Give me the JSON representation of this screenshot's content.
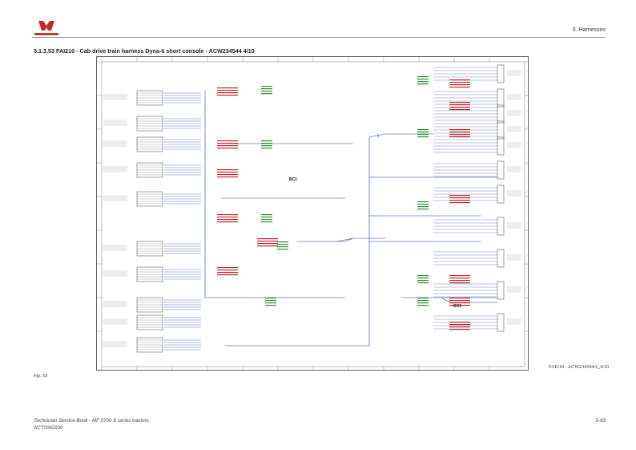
{
  "header": {
    "section": "5. Harnesses"
  },
  "title": "5.1.3.53  FAI210 - Cab drive train harness Dyna-6 short console - ACW234544  4/10",
  "diagram": {
    "figure_code": "FAI210 - ACW234544A_4/10",
    "bus_labels": [
      "BC1",
      "BC3"
    ],
    "colors": {
      "wire": "#1a3fa8",
      "red_text": "#c0282d",
      "green_text": "#2f8f2f",
      "grid": "#555555"
    }
  },
  "figure": {
    "label": "Fig. 53"
  },
  "footer": {
    "manual": "Technician Service Book - MF 5700 S series tractors",
    "code": "ACT0042930",
    "page": "5-63"
  }
}
